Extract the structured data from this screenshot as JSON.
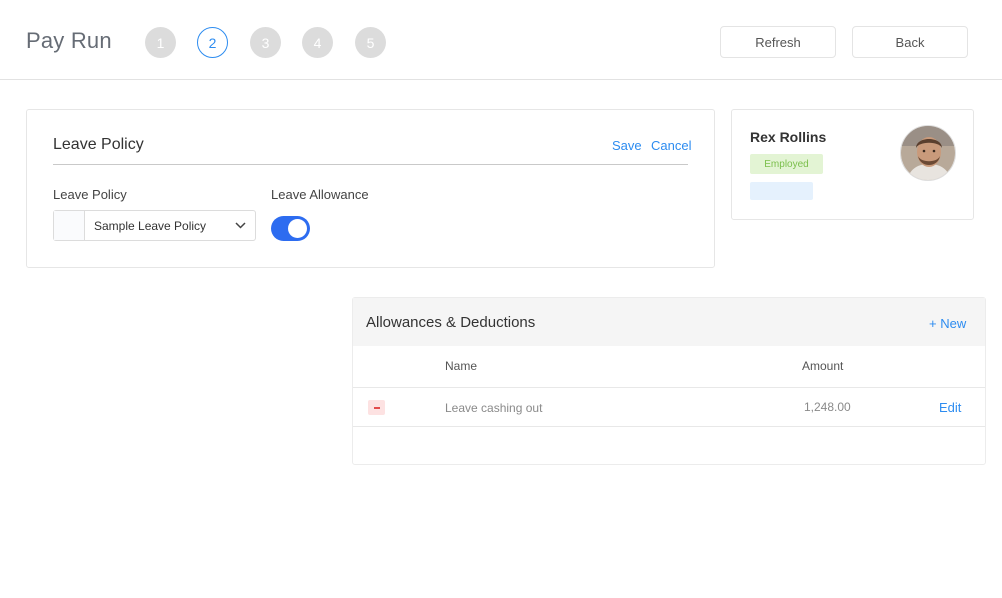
{
  "header": {
    "title": "Pay Run",
    "steps": [
      "1",
      "2",
      "3",
      "4",
      "5"
    ],
    "active_step": "2",
    "refresh_label": "Refresh",
    "back_label": "Back"
  },
  "leave_policy": {
    "title": "Leave Policy",
    "save_label": "Save",
    "cancel_label": "Cancel",
    "policy_label": "Leave Policy",
    "policy_value": "Sample Leave Policy",
    "allowance_label": "Leave Allowance",
    "allowance_enabled": true
  },
  "profile": {
    "name": "Rex Rollins",
    "status": "Employed"
  },
  "allowances": {
    "title": "Allowances & Deductions",
    "new_label": "+ New",
    "columns": {
      "name": "Name",
      "amount": "Amount"
    },
    "rows": [
      {
        "name": "Leave cashing out",
        "amount": "1,248.00",
        "edit_label": "Edit"
      }
    ]
  },
  "colors": {
    "accent": "#2d8cf0",
    "toggle_on": "#2d6cf0",
    "step_inactive": "#dcdcdc",
    "status_bg": "#e3f4d4",
    "status_text": "#7bbf4c",
    "remove_bg": "#fde2e2",
    "remove_icon": "#e24b4b"
  },
  "icons": {
    "select_chevron": "chevron-down-icon",
    "remove": "minus-icon"
  }
}
